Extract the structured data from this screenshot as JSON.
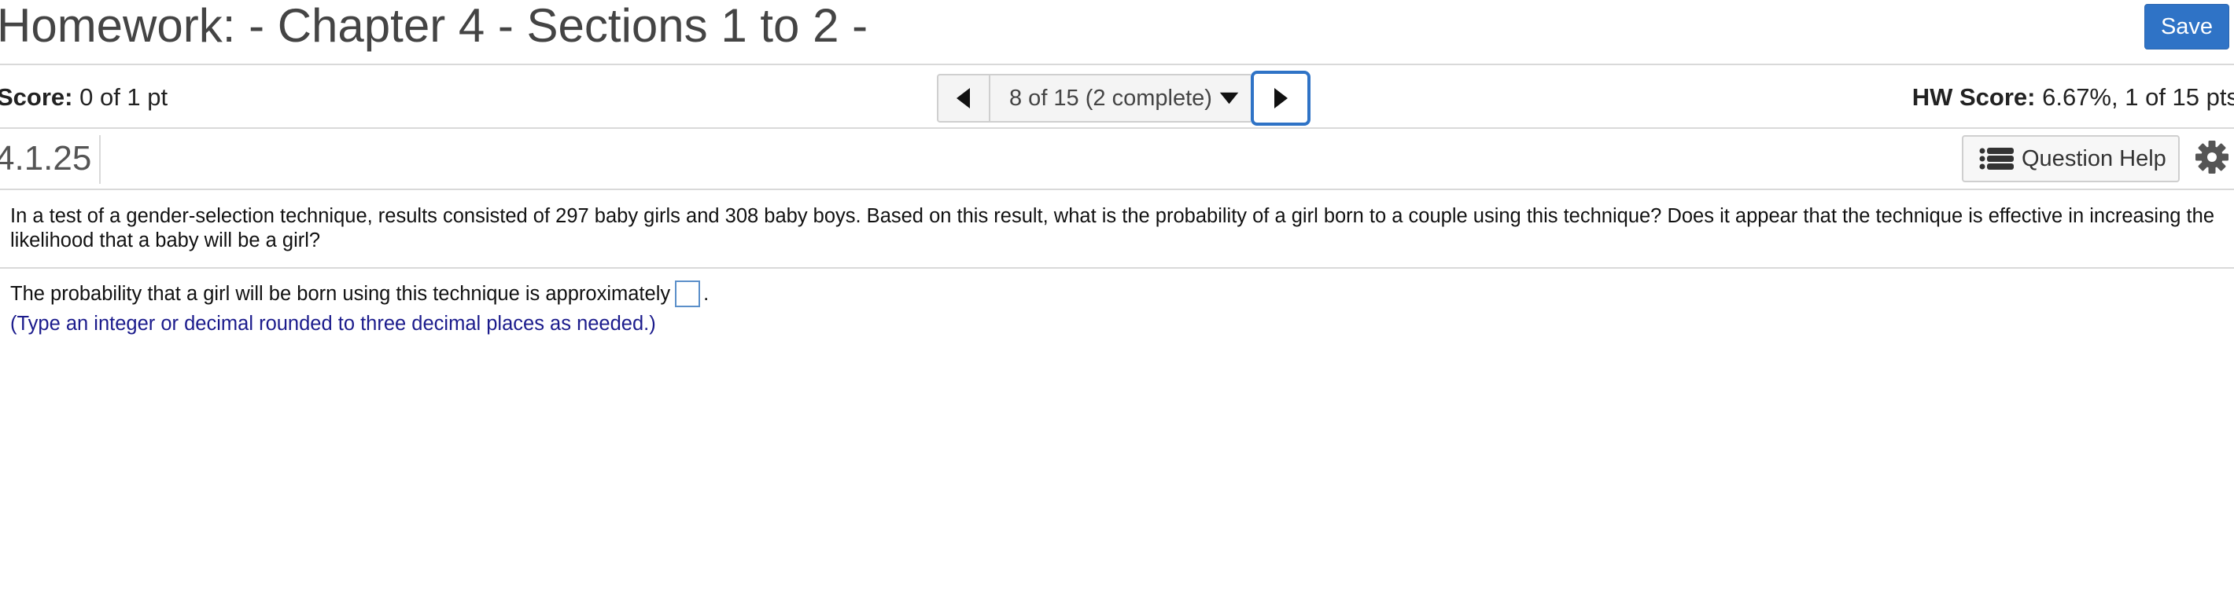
{
  "header": {
    "title": "Homework: - Chapter 4 - Sections 1 to 2 -",
    "save_label": "Save"
  },
  "score_row": {
    "score_label": "Score:",
    "score_value": "0 of 1 pt",
    "nav_position": "8 of 15 (2 complete)",
    "hw_score_label": "HW Score:",
    "hw_score_value": "6.67%, 1 of 15 pts"
  },
  "question_bar": {
    "question_number": "4.1.25",
    "help_label": "Question Help"
  },
  "question": {
    "text": "In a test of a gender-selection technique, results consisted of 297 baby girls and 308 baby boys. Based on this result, what is the probability of a girl born to a couple using this technique? Does it appear that the technique is effective in increasing the likelihood that a baby will be a girl?",
    "answer_prompt": "The probability that a girl will be born using this technique is approximately",
    "answer_suffix": ".",
    "answer_value": "",
    "hint": "(Type an integer or decimal rounded to three decimal places as needed.)"
  },
  "colors": {
    "accent": "#2f73c6",
    "hint": "#1b1b8c",
    "divider": "#d9d9d9"
  },
  "icons": {
    "prev": "triangle-left-icon",
    "next": "triangle-right-icon",
    "dropdown": "caret-down-icon",
    "help": "list-icon",
    "settings": "gear-icon"
  }
}
